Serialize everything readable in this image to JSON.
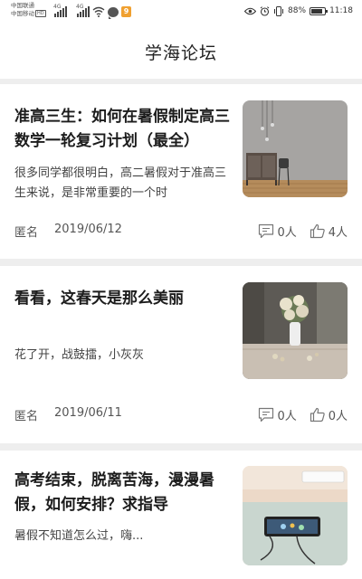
{
  "status_bar": {
    "carrier_line1": "中国联通",
    "carrier_line2": "中国移动",
    "hd_badge": "HD",
    "network_1": "4G",
    "network_2": "4G",
    "notification_app": "9",
    "battery_percent": "88%",
    "time": "11:18",
    "icons": [
      "signal-icon",
      "signal-icon",
      "wifi-icon",
      "message-icon",
      "app-notification-icon",
      "eye-comfort-icon",
      "alarm-icon",
      "vibrate-icon",
      "battery-icon"
    ]
  },
  "header": {
    "title": "学海论坛"
  },
  "posts": [
    {
      "title": "准高三生：如何在暑假制定高三数学一轮复习计划（最全）",
      "excerpt": "很多同学都很明白，高二暑假对于准高三生来说，是非常重要的一个时",
      "author": "匿名",
      "date": "2019/06/12",
      "comments": "0人",
      "likes": "4人",
      "image": "room-with-lamp-and-cabinet"
    },
    {
      "title": "看看，这春天是那么美丽",
      "excerpt": "花了开，战鼓擂，小灰灰",
      "author": "匿名",
      "date": "2019/06/11",
      "comments": "0人",
      "likes": "0人",
      "image": "flower-vase-on-table"
    },
    {
      "title": "高考结束，脱离苦海，漫漫暑假，如何安排？求指导",
      "excerpt": "暑假不知道怎么过，嗨...",
      "image": "tablet-on-desk"
    }
  ],
  "colors": {
    "background": "#ffffff",
    "divider": "#eeeeee",
    "text": "#1c1c1c",
    "meta": "#555555"
  }
}
